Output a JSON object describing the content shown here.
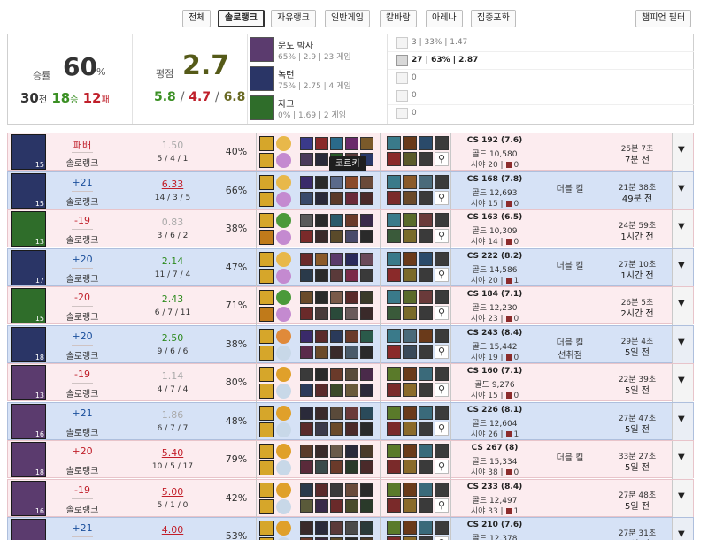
{
  "filters": {
    "tabs": [
      "전체",
      "솔로랭크",
      "자유랭크",
      "일반게임",
      "칼바람",
      "아레나",
      "집중포화"
    ],
    "active_tab": "솔로랭크",
    "champion_filter": "챔피언 필터"
  },
  "summary": {
    "winrate_label": "승률",
    "winrate_value": "60",
    "winrate_unit": "%",
    "games": "30",
    "games_unit": "전",
    "wins": "18",
    "wins_unit": "승",
    "losses": "12",
    "losses_unit": "패",
    "kda_label": "평점",
    "kda_value": "2.7",
    "avg_kills": "5.8",
    "avg_deaths": "4.7",
    "avg_assists": "6.8",
    "slash": "/",
    "champions": [
      {
        "name": "문도 박사",
        "stats": "65%  |  2.9  |  23 게임",
        "color": "#5b3b6e"
      },
      {
        "name": "녹턴",
        "stats": "75%  |  2.75  |  4 게임",
        "color": "#2a3566"
      },
      {
        "name": "자크",
        "stats": "0%  |  1.69  |  2 게임",
        "color": "#2f6d2a"
      }
    ],
    "positions": [
      {
        "text": "3  |  33%  |  1.47",
        "bold": false
      },
      {
        "text": "27  |  63%  |  2.87",
        "bold": true
      },
      {
        "text": "0",
        "bold": false
      },
      {
        "text": "0",
        "bold": false
      },
      {
        "text": "0",
        "bold": false
      }
    ]
  },
  "matches": [
    {
      "result": "loss",
      "lp": "패배",
      "queue": "솔로랭크",
      "kda_ratio": "1.50",
      "kda_style": "grey",
      "kda": "5 / 4 / 1",
      "kp": "40%",
      "cs": "CS 192 (7.6)",
      "gold": "골드 10,580",
      "vision": "시야 20 | ",
      "ward": "0",
      "multi1": "",
      "multi2": "",
      "duration": "25분 7초",
      "ago": "7분 전",
      "level": "15",
      "champ_color": "#2a3566",
      "spell_colors": [
        "#d6a62a",
        "#d6a62a"
      ],
      "rune_colors": [
        "#e8b84a",
        "#c48ad0"
      ],
      "mini_colors": [
        "#3a3a8a",
        "#8a2a2a",
        "#2a6a8a",
        "#6a2a6a",
        "#7a5a2a",
        "#4a3a5a",
        "#2a2a3a",
        "#2a5a2a",
        "#5a3a3a",
        "#2a3a6a"
      ],
      "item_colors": [
        "#3a7a8a",
        "#6a3a1a",
        "#2a4a6a",
        "#8a2a2a",
        "#5a5a2a",
        "#3a3a3a"
      ]
    },
    {
      "result": "win",
      "lp": "+21",
      "queue": "솔로랭크",
      "kda_ratio": "6.33",
      "kda_style": "red",
      "kda": "14 / 3 / 5",
      "kp": "66%",
      "cs": "CS 168 (7.8)",
      "gold": "골드 12,693",
      "vision": "시야 15 | ",
      "ward": "0",
      "multi1": "더블 킬",
      "multi2": "",
      "duration": "21분 38초",
      "ago": "49분 전",
      "level": "15",
      "champ_color": "#2a3566",
      "spell_colors": [
        "#d6a62a",
        "#d6a62a"
      ],
      "rune_colors": [
        "#e8b84a",
        "#c48ad0"
      ],
      "mini_colors": [
        "#3a2a6a",
        "#2a2a2a",
        "#5a6a8a",
        "#8a4a2a",
        "#6a4a3a",
        "#3a4a6a",
        "#2a2a3a",
        "#5a3a2a",
        "#6a2a3a",
        "#4a2a2a"
      ],
      "item_colors": [
        "#3a7a8a",
        "#8a5a2a",
        "#4a6a7a",
        "#7a2a2a",
        "#6a4a2a",
        "#3a3a3a"
      ]
    },
    {
      "result": "loss",
      "lp": "-19",
      "queue": "솔로랭크",
      "kda_ratio": "0.83",
      "kda_style": "grey",
      "kda": "3 / 6 / 2",
      "kp": "38%",
      "cs": "CS 163 (6.5)",
      "gold": "골드 10,309",
      "vision": "시야 14 | ",
      "ward": "0",
      "multi1": "",
      "multi2": "",
      "duration": "24분 59초",
      "ago": "1시간 전",
      "level": "13",
      "champ_color": "#2f6d2a",
      "spell_colors": [
        "#d6a62a",
        "#c07a1a"
      ],
      "rune_colors": [
        "#4a9a3a",
        "#c48ad0"
      ],
      "mini_colors": [
        "#5a5a5a",
        "#2a2a2a",
        "#2a5a6a",
        "#6a3a2a",
        "#3a2a4a",
        "#7a2a2a",
        "#3a2a2a",
        "#5a4a2a",
        "#4a4a6a",
        "#2a2a2a"
      ],
      "item_colors": [
        "#3a7a8a",
        "#5a6a2a",
        "#6a3a3a",
        "#3a5a3a",
        "#7a6a2a",
        "#3a3a3a"
      ]
    },
    {
      "result": "win",
      "lp": "+20",
      "queue": "솔로랭크",
      "kda_ratio": "2.14",
      "kda_style": "green",
      "kda": "11 / 7 / 4",
      "kp": "47%",
      "cs": "CS 222 (8.2)",
      "gold": "골드 14,586",
      "vision": "시야 20 | ",
      "ward": "1",
      "multi1": "더블 킬",
      "multi2": "",
      "duration": "27분 10초",
      "ago": "1시간 전",
      "level": "17",
      "champ_color": "#2a3566",
      "spell_colors": [
        "#d6a62a",
        "#d6a62a"
      ],
      "rune_colors": [
        "#e8b84a",
        "#c48ad0"
      ],
      "mini_colors": [
        "#6a2a2a",
        "#8a5a2a",
        "#5a3a6a",
        "#2a2a5a",
        "#6a4a5a",
        "#2a3a4a",
        "#2a2a2a",
        "#5a3a3a",
        "#7a2a4a",
        "#3a3a3a"
      ],
      "item_colors": [
        "#3a7a8a",
        "#6a3a1a",
        "#2a4a6a",
        "#8a2a2a",
        "#7a6a2a",
        "#3a3a3a"
      ]
    },
    {
      "result": "loss",
      "lp": "-20",
      "queue": "솔로랭크",
      "kda_ratio": "2.43",
      "kda_style": "green",
      "kda": "6 / 7 / 11",
      "kp": "71%",
      "cs": "CS 184 (7.1)",
      "gold": "골드 12,230",
      "vision": "시야 23 | ",
      "ward": "0",
      "multi1": "",
      "multi2": "",
      "duration": "26분 5초",
      "ago": "2시간 전",
      "level": "15",
      "champ_color": "#2f6d2a",
      "spell_colors": [
        "#d6a62a",
        "#c07a1a"
      ],
      "rune_colors": [
        "#4a9a3a",
        "#c48ad0"
      ],
      "mini_colors": [
        "#6a4a2a",
        "#2a2a2a",
        "#7a5a4a",
        "#5a2a2a",
        "#3a3a2a",
        "#6a2a2a",
        "#4a3a3a",
        "#2a4a3a",
        "#6a5a5a",
        "#3a2a2a"
      ],
      "item_colors": [
        "#3a7a8a",
        "#5a6a2a",
        "#6a3a3a",
        "#3a5a3a",
        "#7a6a2a",
        "#3a3a3a"
      ]
    },
    {
      "result": "win",
      "lp": "+20",
      "queue": "솔로랭크",
      "kda_ratio": "2.50",
      "kda_style": "green",
      "kda": "9 / 6 / 6",
      "kp": "38%",
      "cs": "CS 243 (8.4)",
      "gold": "골드 15,442",
      "vision": "시야 19 | ",
      "ward": "0",
      "multi1": "더블 킬",
      "multi2": "선취점",
      "duration": "29분 4초",
      "ago": "5일 전",
      "level": "18",
      "champ_color": "#2a3566",
      "spell_colors": [
        "#d6a62a",
        "#d6a62a"
      ],
      "rune_colors": [
        "#e08a3a",
        "#c8d8e8"
      ],
      "mini_colors": [
        "#3a2a6a",
        "#5a2a2a",
        "#2a3a5a",
        "#6a3a2a",
        "#2a5a4a",
        "#5a2a4a",
        "#6a4a2a",
        "#3a2a2a",
        "#4a5a6a",
        "#2a2a2a"
      ],
      "item_colors": [
        "#3a7a8a",
        "#4a6a7a",
        "#6a3a1a",
        "#8a2a2a",
        "#3a4a5a",
        "#3a3a3a"
      ]
    },
    {
      "result": "loss",
      "lp": "-19",
      "queue": "솔로랭크",
      "kda_ratio": "1.14",
      "kda_style": "grey",
      "kda": "4 / 7 / 4",
      "kp": "80%",
      "cs": "CS 160 (7.1)",
      "gold": "골드 9,276",
      "vision": "시야 15 | ",
      "ward": "0",
      "multi1": "",
      "multi2": "",
      "duration": "22분 39초",
      "ago": "5일 전",
      "level": "13",
      "champ_color": "#5b3b6e",
      "spell_colors": [
        "#d6a62a",
        "#d6a62a"
      ],
      "rune_colors": [
        "#e0a02a",
        "#c8d8e8"
      ],
      "mini_colors": [
        "#3a3a3a",
        "#2a2a2a",
        "#6a3a2a",
        "#5a4a3a",
        "#4a2a4a",
        "#2a3a5a",
        "#5a2a2a",
        "#3a4a2a",
        "#6a5a3a",
        "#2a2a3a"
      ],
      "item_colors": [
        "#5a7a2a",
        "#6a3a1a",
        "#3a6a7a",
        "#7a2a2a",
        "#8a6a2a",
        "#3a3a3a"
      ]
    },
    {
      "result": "win",
      "lp": "+21",
      "queue": "솔로랭크",
      "kda_ratio": "1.86",
      "kda_style": "grey",
      "kda": "6 / 7 / 7",
      "kp": "48%",
      "cs": "CS 226 (8.1)",
      "gold": "골드 12,604",
      "vision": "시야 26 | ",
      "ward": "1",
      "multi1": "",
      "multi2": "",
      "duration": "27분 47초",
      "ago": "5일 전",
      "level": "16",
      "champ_color": "#5b3b6e",
      "spell_colors": [
        "#d6a62a",
        "#d6a62a"
      ],
      "rune_colors": [
        "#e0a02a",
        "#c8d8e8"
      ],
      "mini_colors": [
        "#2a2a3a",
        "#3a2a2a",
        "#5a4a3a",
        "#6a3a3a",
        "#2a4a5a",
        "#5a2a2a",
        "#3a3a4a",
        "#6a4a2a",
        "#4a2a2a",
        "#2a2a2a"
      ],
      "item_colors": [
        "#5a7a2a",
        "#6a3a1a",
        "#3a6a7a",
        "#7a2a2a",
        "#8a6a2a",
        "#3a3a3a"
      ]
    },
    {
      "result": "loss",
      "lp": "+20",
      "queue": "솔로랭크",
      "kda_ratio": "5.40",
      "kda_style": "red",
      "kda": "10 / 5 / 17",
      "kp": "79%",
      "cs": "CS 267 (8)",
      "gold": "골드 15,334",
      "vision": "시야 38 | ",
      "ward": "0",
      "multi1": "더블 킬",
      "multi2": "",
      "duration": "33분 27초",
      "ago": "5일 전",
      "level": "18",
      "champ_color": "#5b3b6e",
      "spell_colors": [
        "#d6a62a",
        "#d6a62a"
      ],
      "rune_colors": [
        "#e0a02a",
        "#c8d8e8"
      ],
      "mini_colors": [
        "#5a3a2a",
        "#3a2a2a",
        "#6a5a4a",
        "#2a2a3a",
        "#4a3a2a",
        "#5a2a3a",
        "#3a4a4a",
        "#6a3a2a",
        "#2a3a2a",
        "#4a2a2a"
      ],
      "item_colors": [
        "#5a7a2a",
        "#6a3a1a",
        "#3a6a7a",
        "#7a2a2a",
        "#8a6a2a",
        "#3a3a3a"
      ]
    },
    {
      "result": "loss",
      "lp": "-19",
      "queue": "솔로랭크",
      "kda_ratio": "5.00",
      "kda_style": "red",
      "kda": "5 / 1 / 0",
      "kp": "42%",
      "cs": "CS 233 (8.4)",
      "gold": "골드 12,497",
      "vision": "시야 33 | ",
      "ward": "1",
      "multi1": "",
      "multi2": "",
      "duration": "27분 48초",
      "ago": "5일 전",
      "level": "16",
      "champ_color": "#5b3b6e",
      "spell_colors": [
        "#d6a62a",
        "#d6a62a"
      ],
      "rune_colors": [
        "#e0a02a",
        "#c8d8e8"
      ],
      "mini_colors": [
        "#2a3a4a",
        "#5a2a2a",
        "#3a3a3a",
        "#6a4a3a",
        "#2a2a2a",
        "#5a5a3a",
        "#3a2a4a",
        "#6a2a2a",
        "#4a4a2a",
        "#2a3a2a"
      ],
      "item_colors": [
        "#5a7a2a",
        "#6a3a1a",
        "#3a6a7a",
        "#7a2a2a",
        "#8a6a2a",
        "#3a3a3a"
      ]
    },
    {
      "result": "win",
      "lp": "+21",
      "queue": "솔로랭크",
      "kda_ratio": "4.00",
      "kda_style": "red",
      "kda": "",
      "kp": "53%",
      "cs": "CS 210 (7.6)",
      "gold": "골드 12,378",
      "vision": "",
      "ward": "",
      "multi1": "",
      "multi2": "",
      "duration": "27분 31초",
      "ago": "5일 전",
      "level": "",
      "champ_color": "#5b3b6e",
      "spell_colors": [
        "#d6a62a",
        "#d6a62a"
      ],
      "rune_colors": [
        "#e0a02a",
        "#c8d8e8"
      ],
      "mini_colors": [
        "#3a2a2a",
        "#2a2a3a",
        "#5a3a3a",
        "#4a4a4a",
        "#2a3a3a",
        "#6a3a2a",
        "#3a2a3a",
        "#5a4a2a",
        "#2a2a2a",
        "#4a3a2a"
      ],
      "item_colors": [
        "#5a7a2a",
        "#6a3a1a",
        "#3a6a7a",
        "#7a2a2a",
        "#8a6a2a",
        "#3a3a3a"
      ]
    }
  ],
  "tooltip": "코르키"
}
